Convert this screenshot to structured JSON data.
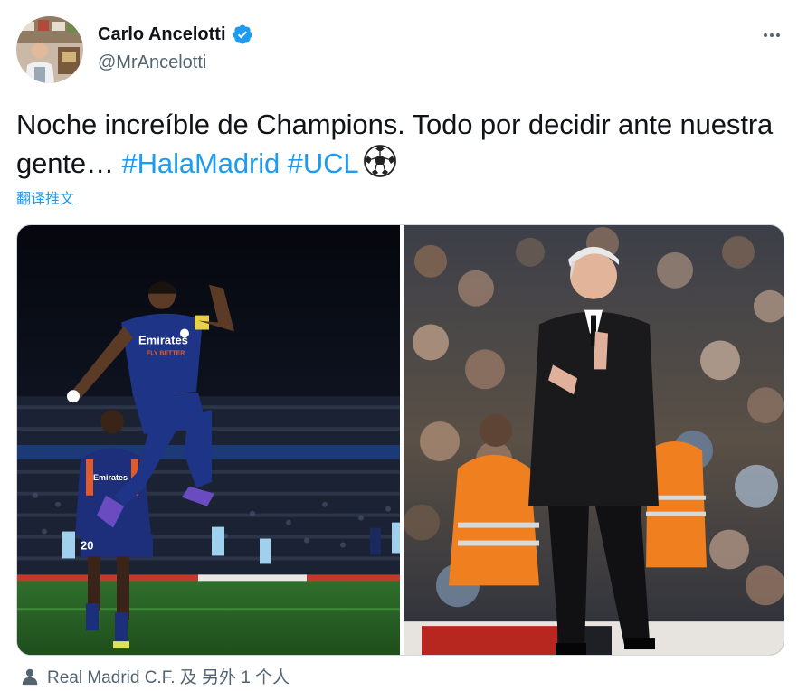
{
  "author": {
    "display_name": "Carlo Ancelotti",
    "handle": "@MrAncelotti",
    "verified": true
  },
  "tweet": {
    "text_part1": "Noche increíble de Champions. Todo por decidir ante nuestra gente… ",
    "hashtag1": "#HalaMadrid",
    "hashtag2": "#UCL",
    "emoji": "soccer-ball",
    "translate_label": "翻译推文"
  },
  "media": {
    "left_photo": {
      "shirt_sponsor": "Emirates",
      "shirt_sub": "FLY BETTER",
      "number": "20"
    },
    "right_photo": {}
  },
  "tagged": {
    "label": "Real Madrid C.F. 及 另外 1 个人"
  },
  "colors": {
    "accent": "#1d9bf0",
    "text": "#0f1419",
    "secondary": "#536471"
  }
}
